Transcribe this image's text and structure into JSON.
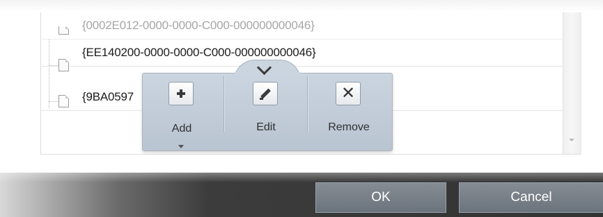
{
  "list": {
    "rows": [
      {
        "text": "{0002E012-0000-0000-C000-000000000046}",
        "state": "faded"
      },
      {
        "text": "{EE140200-0000-0000-C000-000000000046}",
        "state": "normal"
      },
      {
        "text": "{9BA0597",
        "state": "normal"
      }
    ]
  },
  "popup_toolbar": {
    "collapse_icon": "chevron-down-icon",
    "tools": [
      {
        "label": "Add",
        "icon": "plus-icon",
        "has_dropdown": true
      },
      {
        "label": "Edit",
        "icon": "pencil-icon",
        "has_dropdown": false
      },
      {
        "label": "Remove",
        "icon": "x-icon",
        "has_dropdown": false
      }
    ]
  },
  "dialog_buttons": {
    "ok_label": "OK",
    "cancel_label": "Cancel"
  },
  "colors": {
    "popup_bg": "#c4cfdb",
    "dialog_button_bg": "#7a828b",
    "bottom_bar_bg": "#333333"
  }
}
